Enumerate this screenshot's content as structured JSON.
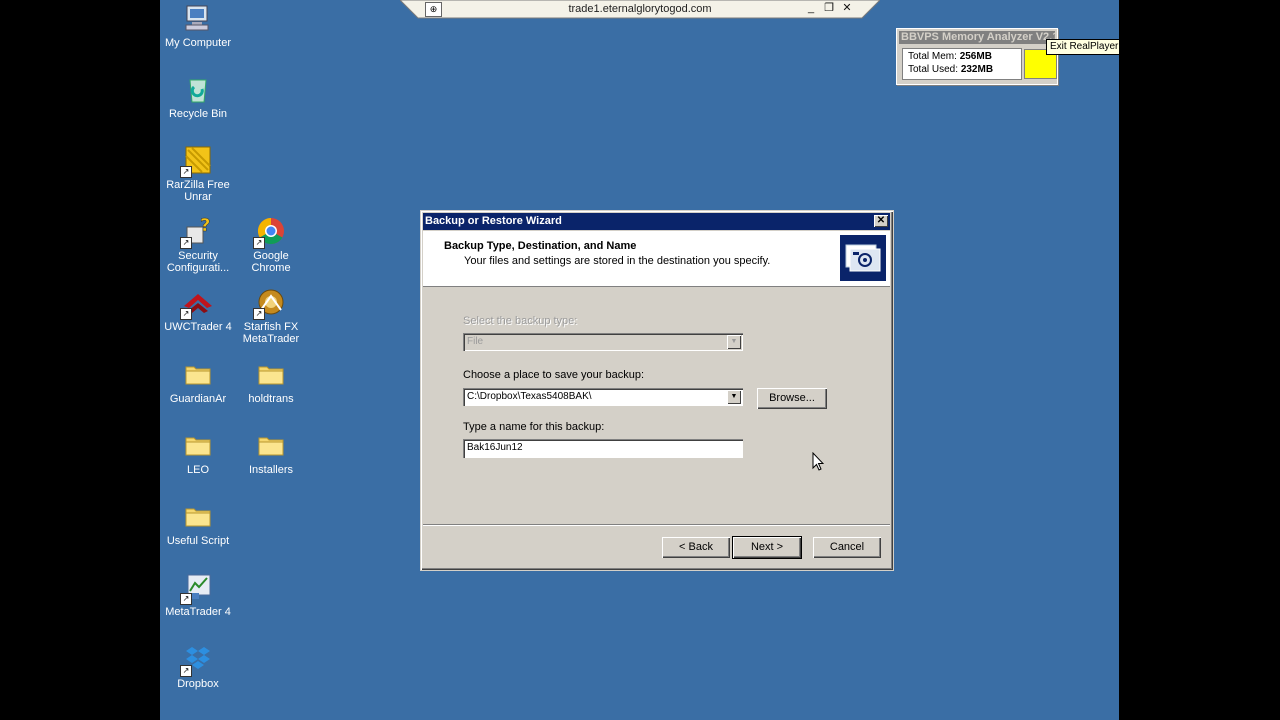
{
  "rdp_bar": {
    "title": "trade1.eternalglorytogod.com",
    "pin_icon": "pin-icon",
    "minimize": "_",
    "restore": "❐",
    "close": "✕"
  },
  "desktop_icons": [
    {
      "label": "My Computer",
      "icon": "computer-icon",
      "shortcut": false
    },
    {
      "label": "Recycle Bin",
      "icon": "recycle-bin-icon",
      "shortcut": false
    },
    {
      "label": "RarZilla Free Unrar",
      "icon": "archive-icon",
      "shortcut": true
    },
    {
      "label": "Security Configurati...",
      "icon": "security-config-icon",
      "shortcut": true
    },
    {
      "label": "Google Chrome",
      "icon": "chrome-icon",
      "shortcut": true
    },
    {
      "label": "UWCTrader 4",
      "icon": "uwctrader-icon",
      "shortcut": true
    },
    {
      "label": "Starfish FX MetaTrader",
      "icon": "metatrader-icon",
      "shortcut": true
    },
    {
      "label": "GuardianAr",
      "icon": "folder-icon",
      "shortcut": false
    },
    {
      "label": "holdtrans",
      "icon": "folder-icon",
      "shortcut": false
    },
    {
      "label": "LEO",
      "icon": "folder-icon",
      "shortcut": false
    },
    {
      "label": "Installers",
      "icon": "folder-icon",
      "shortcut": false
    },
    {
      "label": "Useful Script",
      "icon": "folder-icon",
      "shortcut": false
    },
    {
      "label": "MetaTrader 4",
      "icon": "metatrader-icon",
      "shortcut": true
    },
    {
      "label": "Dropbox",
      "icon": "dropbox-icon",
      "shortcut": true
    }
  ],
  "memory_widget": {
    "title": "BBVPS Memory Analyzer V2.1",
    "total_mem_label": "Total Mem:",
    "total_mem_value": "256MB",
    "total_used_label": "Total Used:",
    "total_used_value": "232MB",
    "indicator_color": "#ffff00"
  },
  "tooltip": "Exit RealPlayer",
  "wizard": {
    "title": "Backup or Restore Wizard",
    "header_title": "Backup Type, Destination, and Name",
    "header_subtitle": "Your files and settings are stored in the destination you specify.",
    "backup_type_label": "Select the backup type:",
    "backup_type_value": "File",
    "place_label": "Choose a place to save your backup:",
    "place_value": "C:\\Dropbox\\Texas5408BAK\\",
    "browse_button": "Browse...",
    "name_label": "Type a name for this backup:",
    "name_value": "Bak16Jun12",
    "back_button": "< Back",
    "next_button": "Next >",
    "cancel_button": "Cancel",
    "close_glyph": "✕",
    "combo_arrow": "▼"
  },
  "colors": {
    "desktop": "#3a6ea5",
    "titlebar": "#0a246a",
    "dialog": "#d4d0c8"
  }
}
